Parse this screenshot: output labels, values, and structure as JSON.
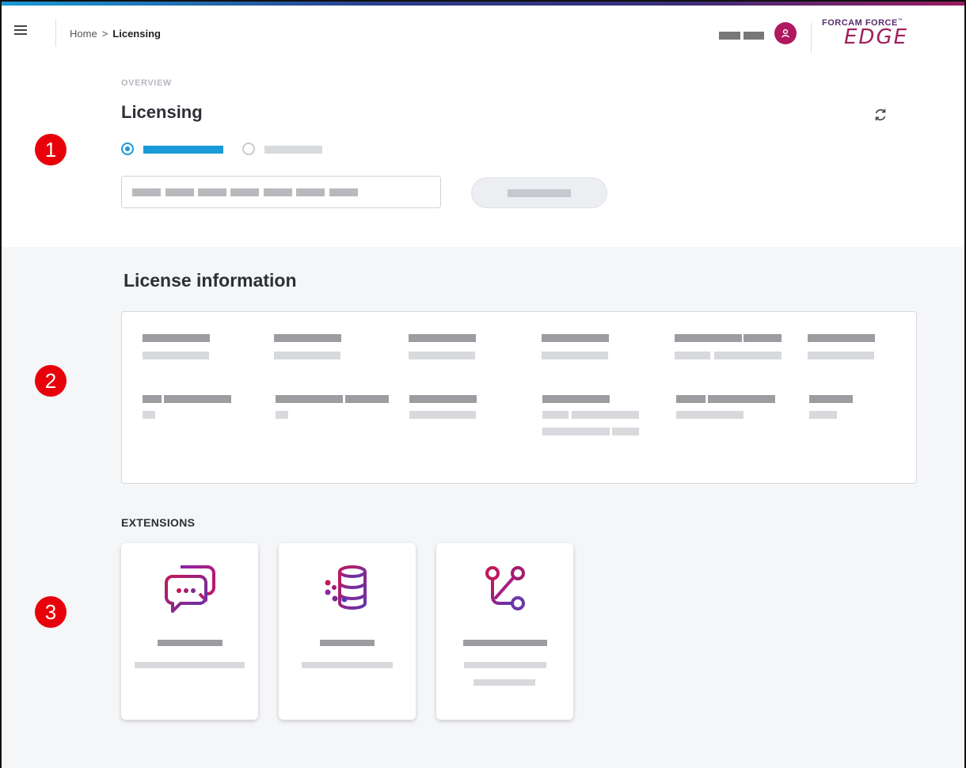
{
  "header": {
    "breadcrumb": {
      "home": "Home",
      "separator": ">",
      "current": "Licensing"
    },
    "logo": {
      "top_text": "FORCAM FORCE",
      "trademark": "™",
      "main_text": "EDGE"
    },
    "accent_color": "#b0195f"
  },
  "overview": {
    "overline": "OVERVIEW",
    "title": "Licensing"
  },
  "markers": [
    "1",
    "2",
    "3"
  ],
  "license_info": {
    "heading": "License information"
  },
  "extensions": {
    "heading": "EXTENSIONS",
    "cards": [
      {
        "icon": "chat-bubbles-icon"
      },
      {
        "icon": "database-icon"
      },
      {
        "icon": "git-branch-icon"
      }
    ]
  },
  "colors": {
    "primary_blue": "#1a9ad6",
    "brand_magenta": "#a01e5a",
    "marker_red": "#e8000b"
  }
}
